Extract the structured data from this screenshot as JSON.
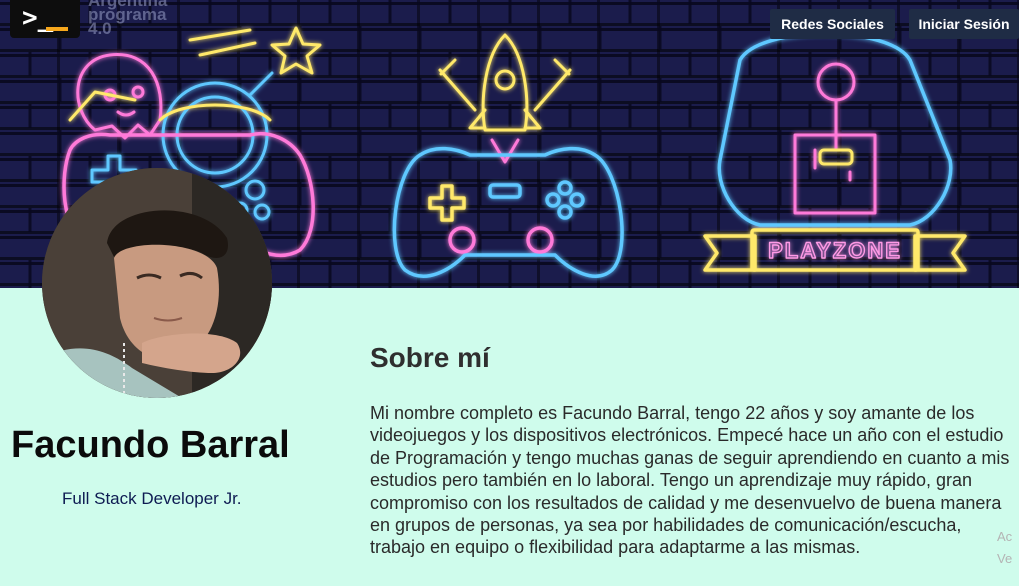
{
  "header": {
    "logo_prompt": ">_",
    "logo_text": [
      "Argentina",
      "programa",
      "4.0"
    ],
    "nav": {
      "social_label": "Redes Sociales",
      "login_label": "Iniciar Sesión"
    },
    "banner_sign": "PLAYZONE"
  },
  "profile": {
    "name": "Facundo Barral",
    "role": "Full Stack Developer Jr."
  },
  "about": {
    "title": "Sobre mí",
    "text": "Mi nombre completo es Facundo Barral, tengo 22 años y soy amante de los videojuegos y los dispositivos electrónicos. Empecé hace un año con el estudio de Programación y tengo muchas ganas de seguir aprendiendo en cuanto a mis estudios pero también en lo laboral. Tengo un aprendizaje muy rápido, gran compromiso con los resultados de calidad y me desenvuelvo de buena manera en grupos de personas, ya sea por habilidades de comunicación/escucha, trabajo en equipo o flexibilidad para adaptarme a las mismas."
  },
  "edge_text": [
    "Ac",
    "Ve"
  ],
  "colors": {
    "page_bg": "#cffcec",
    "banner_bg": "#1b1c4c",
    "nav_bg": "#1f2c45",
    "neon_blue": "#5ec8ff",
    "neon_pink": "#ff7ad9",
    "neon_yellow": "#ffe96b"
  }
}
